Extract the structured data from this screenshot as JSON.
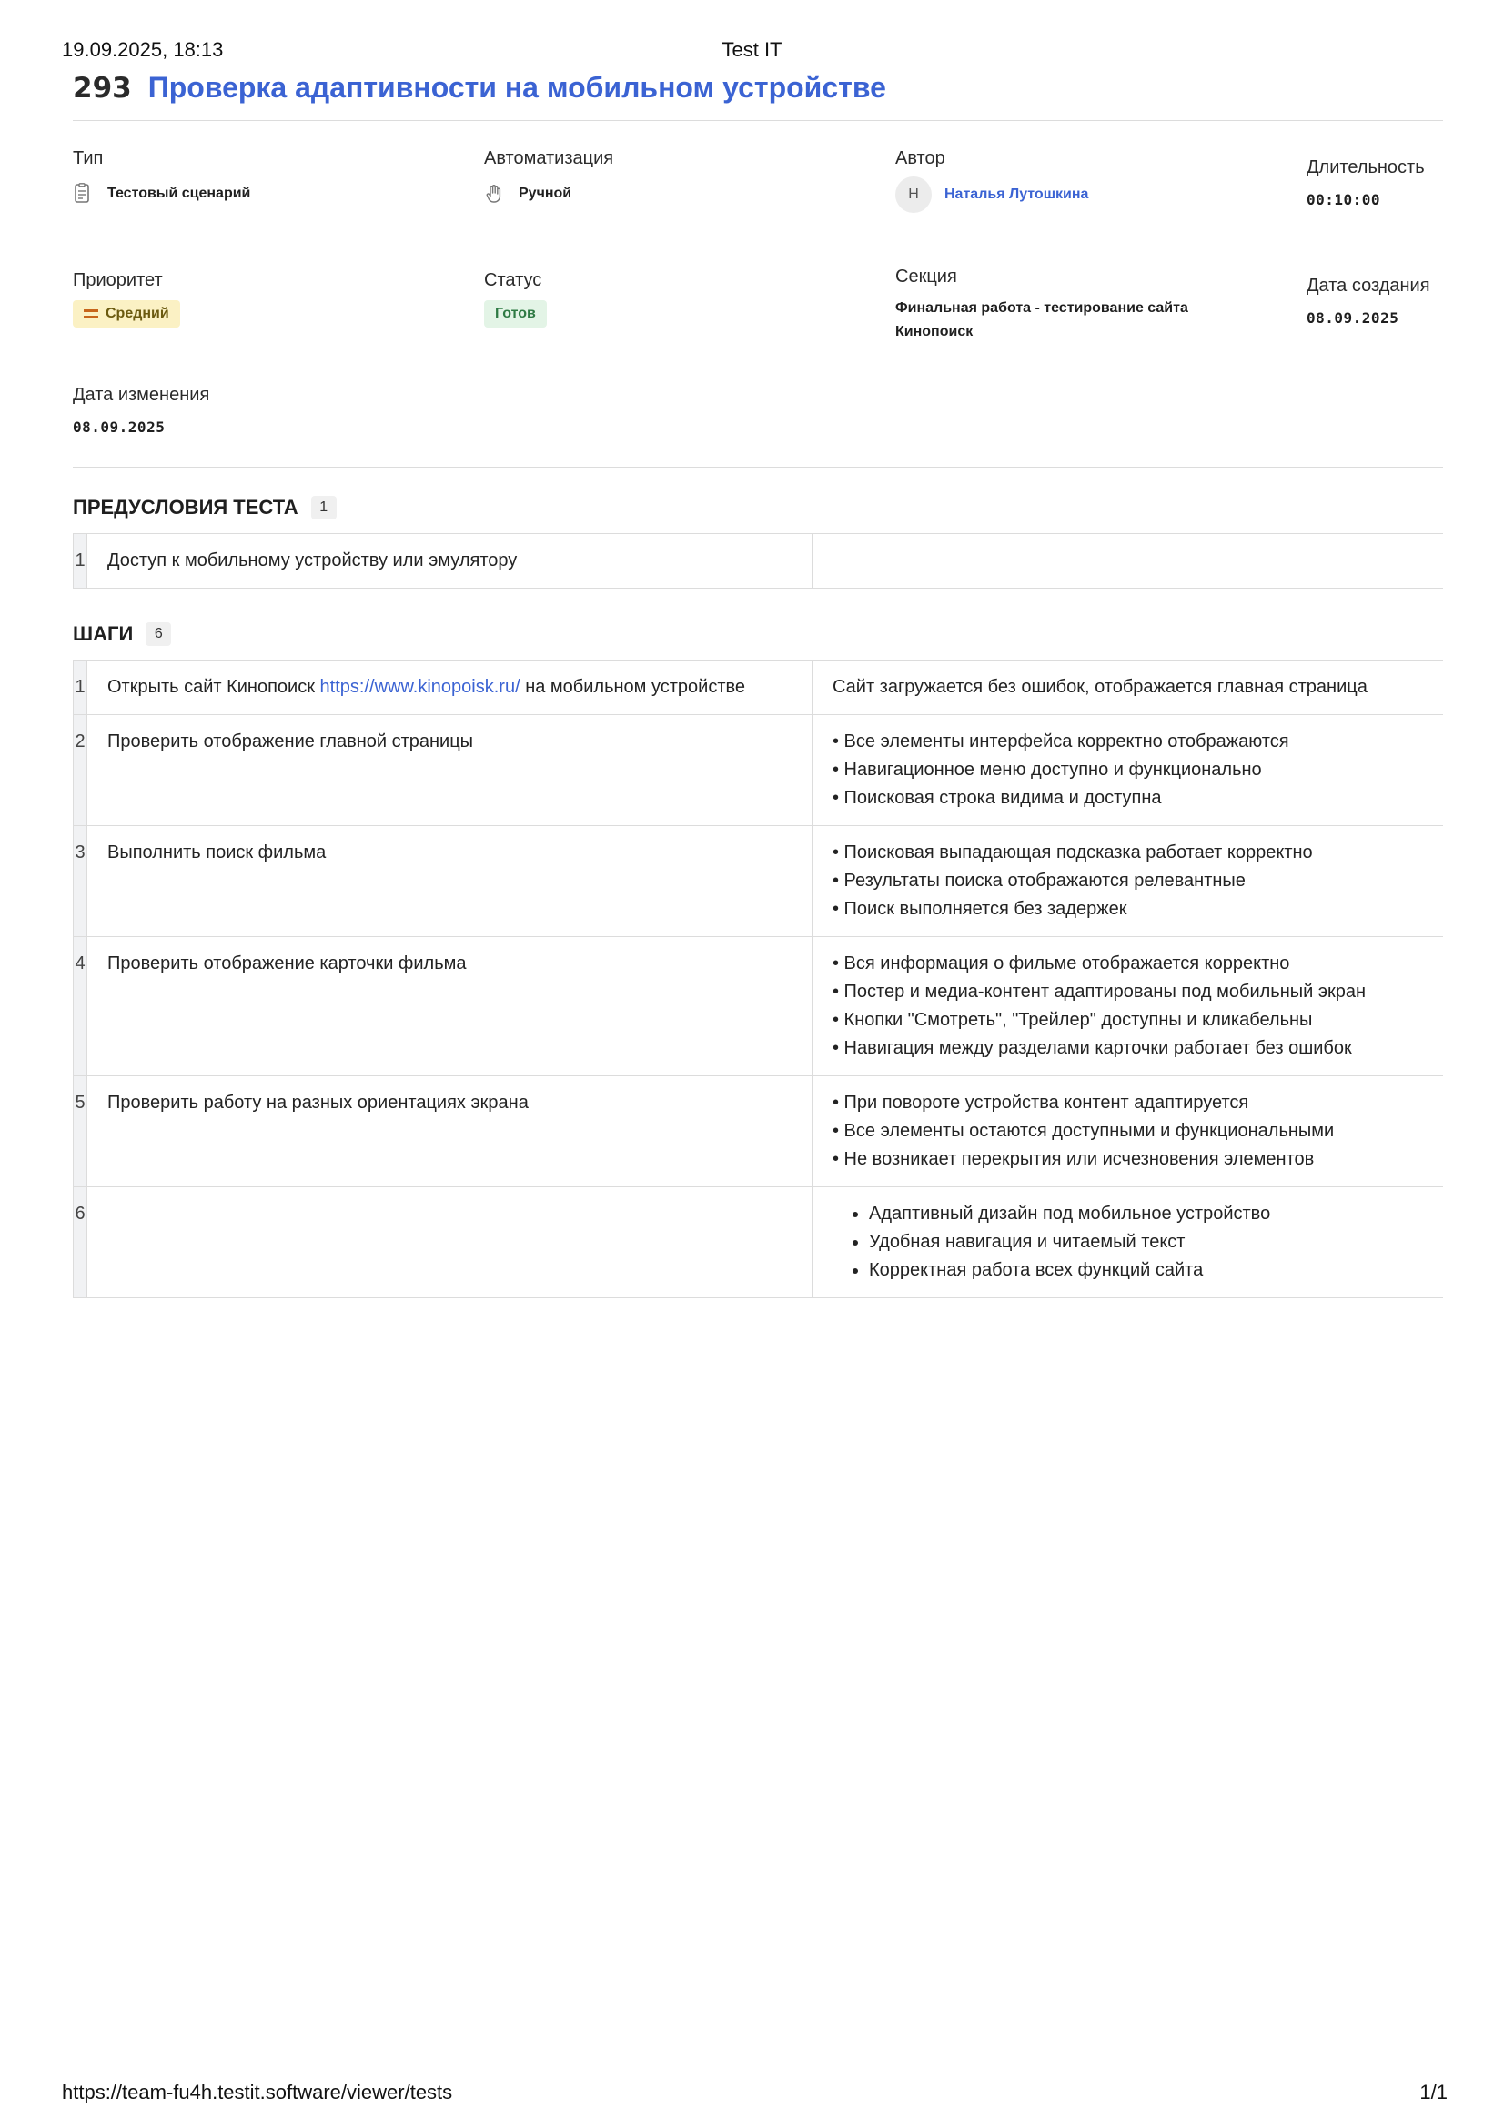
{
  "print_header": {
    "datetime": "19.09.2025, 18:13",
    "app_title": "Test IT"
  },
  "print_footer": {
    "url": "https://team-fu4h.testit.software/viewer/tests",
    "page": "1/1"
  },
  "test": {
    "id": "293",
    "title": "Проверка адаптивности на мобильном устройстве"
  },
  "meta": {
    "type": {
      "label": "Тип",
      "value": "Тестовый сценарий",
      "icon": "document-icon"
    },
    "automation": {
      "label": "Автоматизация",
      "value": "Ручной",
      "icon": "hand-icon"
    },
    "author": {
      "label": "Автор",
      "avatar_initial": "Н",
      "name": "Наталья Лутошкина"
    },
    "duration": {
      "label": "Длительность",
      "value": "00:10:00"
    },
    "priority": {
      "label": "Приоритет",
      "value": "Средний",
      "color": "#fbf1c4"
    },
    "status": {
      "label": "Статус",
      "value": "Готов",
      "color": "#e3f4e6"
    },
    "section": {
      "label": "Секция",
      "value": "Финальная работа - тестирование сайта Кинопоиск"
    },
    "created": {
      "label": "Дата создания",
      "value": "08.09.2025"
    },
    "modified": {
      "label": "Дата изменения",
      "value": "08.09.2025"
    }
  },
  "preconditions": {
    "heading": "ПРЕДУСЛОВИЯ ТЕСТА",
    "count": "1",
    "rows": [
      {
        "num": "1",
        "action": "Доступ к мобильному устройству или эмулятору",
        "result": ""
      }
    ]
  },
  "steps": {
    "heading": "ШАГИ",
    "count": "6",
    "rows": [
      {
        "num": "1",
        "action_prefix": "Открыть сайт Кинопоиск ",
        "action_link": "https://www.kinopoisk.ru/",
        "action_suffix": " на мобильном устройстве",
        "result": "Сайт загружается без ошибок, отображается главная страница"
      },
      {
        "num": "2",
        "action": "Проверить отображение главной страницы",
        "results": [
          "• Все элементы интерфейса корректно отображаются",
          "• Навигационное меню доступно и функционально",
          "• Поисковая строка видима и доступна"
        ]
      },
      {
        "num": "3",
        "action": "Выполнить поиск фильма",
        "results": [
          "• Поисковая выпадающая подсказка работает корректно",
          "• Результаты поиска отображаются релевантные",
          "• Поиск выполняется без задержек"
        ]
      },
      {
        "num": "4",
        "action": "Проверить отображение карточки фильма",
        "results": [
          "• Вся информация о фильме отображается корректно",
          "• Постер и медиа-контент адаптированы под мобильный экран",
          "• Кнопки \"Смотреть\", \"Трейлер\" доступны и кликабельны",
          "• Навигация между разделами карточки работает без ошибок"
        ]
      },
      {
        "num": "5",
        "action": "Проверить работу на разных ориентациях экрана",
        "results": [
          "• При повороте устройства контент адаптируется",
          "• Все элементы остаются доступными и функциональными",
          "• Не возникает перекрытия или исчезновения элементов"
        ]
      },
      {
        "num": "6",
        "action": "",
        "list": [
          "Адаптивный дизайн под мобильное устройство",
          "Удобная навигация и читаемый текст",
          "Корректная работа всех функций сайта"
        ]
      }
    ]
  }
}
